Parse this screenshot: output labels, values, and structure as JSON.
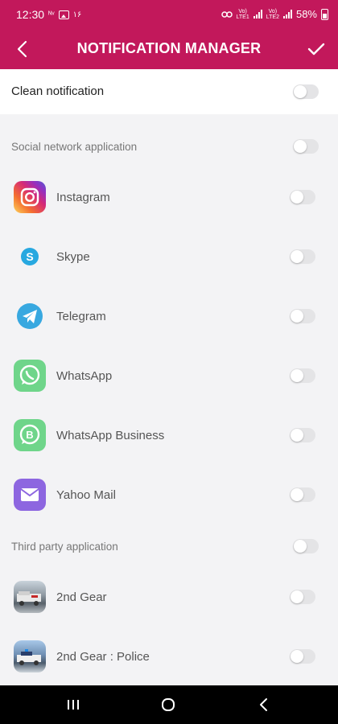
{
  "status_bar": {
    "time": "12:30",
    "net_label": "ᴺᵛ",
    "extra": "۱۶",
    "volte1": "Vo)) LTE1",
    "volte2": "Vo)) LTE2",
    "battery": "58%"
  },
  "app_bar": {
    "title": "NOTIFICATION MANAGER",
    "back_icon": "chevron-left-icon",
    "confirm_icon": "check-icon"
  },
  "master": {
    "label": "Clean notification",
    "enabled": false
  },
  "sections": [
    {
      "label": "Social network application",
      "enabled": false,
      "apps": [
        {
          "name": "Instagram",
          "icon": "instagram-icon",
          "enabled": false
        },
        {
          "name": "Skype",
          "icon": "skype-icon",
          "enabled": false
        },
        {
          "name": "Telegram",
          "icon": "telegram-icon",
          "enabled": false
        },
        {
          "name": "WhatsApp",
          "icon": "whatsapp-icon",
          "enabled": false
        },
        {
          "name": "WhatsApp Business",
          "icon": "whatsapp-business-icon",
          "enabled": false
        },
        {
          "name": "Yahoo Mail",
          "icon": "yahoo-mail-icon",
          "enabled": false
        }
      ]
    },
    {
      "label": "Third party application",
      "enabled": false,
      "apps": [
        {
          "name": "2nd Gear",
          "icon": "game-icon",
          "enabled": false
        },
        {
          "name": "2nd Gear : Police",
          "icon": "game-police-icon",
          "enabled": false
        }
      ]
    }
  ],
  "colors": {
    "brand": "#c2185b",
    "background": "#f3f3f5",
    "toggle_off": "#e4e4e6"
  },
  "nav_bar": {
    "recents_icon": "recents-icon",
    "home_icon": "home-icon",
    "back_icon": "back-icon"
  }
}
